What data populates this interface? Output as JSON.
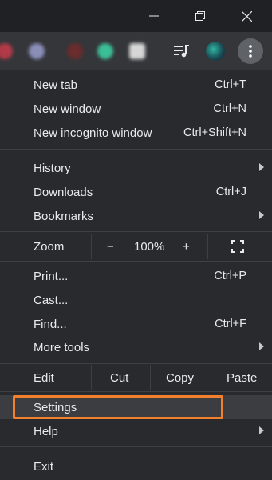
{
  "window": {
    "minimize_icon": "minimize-icon",
    "maximize_icon": "restore-icon",
    "close_icon": "close-icon"
  },
  "toolbar": {
    "queue_icon": "media-queue-icon",
    "menu_icon": "kebab-menu-icon"
  },
  "menu": {
    "new_tab": {
      "label": "New tab",
      "shortcut": "Ctrl+T"
    },
    "new_window": {
      "label": "New window",
      "shortcut": "Ctrl+N"
    },
    "new_incognito": {
      "label": "New incognito window",
      "shortcut": "Ctrl+Shift+N"
    },
    "history": {
      "label": "History"
    },
    "downloads": {
      "label": "Downloads",
      "shortcut": "Ctrl+J"
    },
    "bookmarks": {
      "label": "Bookmarks"
    },
    "zoom": {
      "label": "Zoom",
      "minus": "−",
      "value": "100%",
      "plus": "+"
    },
    "print": {
      "label": "Print...",
      "shortcut": "Ctrl+P"
    },
    "cast": {
      "label": "Cast..."
    },
    "find": {
      "label": "Find...",
      "shortcut": "Ctrl+F"
    },
    "more_tools": {
      "label": "More tools"
    },
    "edit": {
      "label": "Edit",
      "cut": "Cut",
      "copy": "Copy",
      "paste": "Paste"
    },
    "settings": {
      "label": "Settings"
    },
    "help": {
      "label": "Help"
    },
    "exit": {
      "label": "Exit"
    }
  },
  "colors": {
    "highlight": "#f3802d",
    "menu_bg": "#292a2d",
    "text": "#e8eaed"
  }
}
